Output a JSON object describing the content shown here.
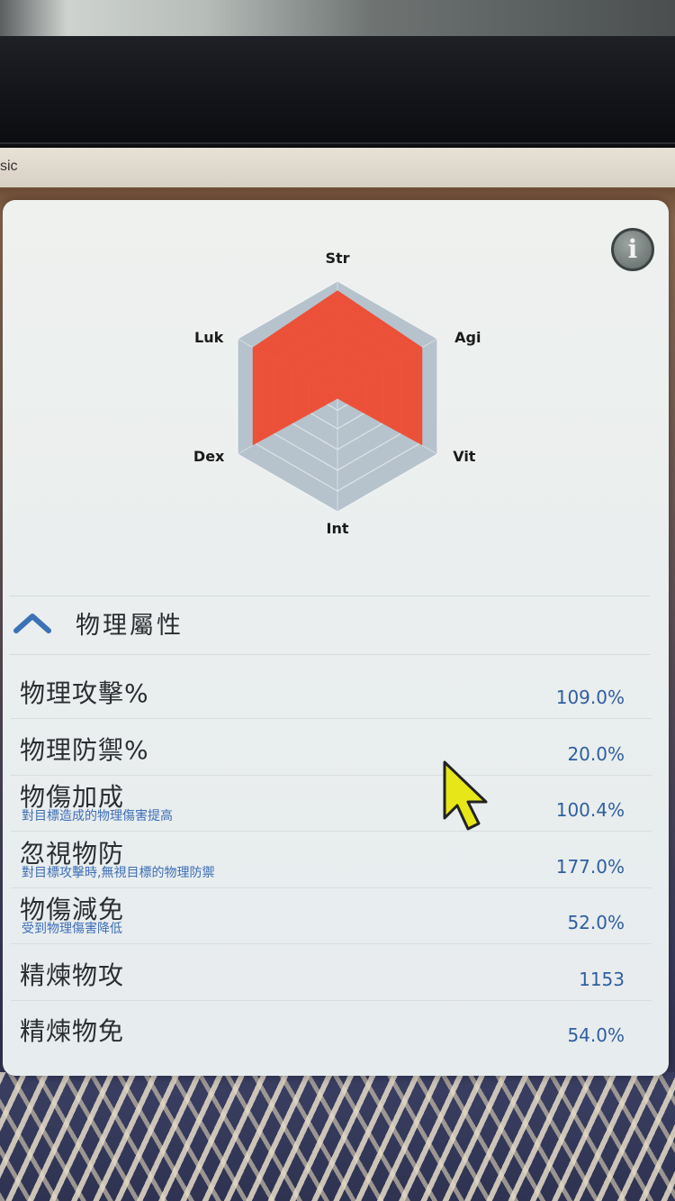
{
  "window": {
    "title_fragment": "sic"
  },
  "info_button": {
    "icon": "info-icon",
    "glyph": "i"
  },
  "chart_data": {
    "type": "radar",
    "axes": [
      "Str",
      "Agi",
      "Vit",
      "Int",
      "Dex",
      "Luk"
    ],
    "max": 1.0,
    "series": [
      {
        "values": [
          0.92,
          0.85,
          0.85,
          0.02,
          0.85,
          0.85
        ],
        "color": "#ee4a30"
      }
    ],
    "ring_color": "#b6c3cc"
  },
  "section": {
    "title": "物理屬性",
    "icon": "chevron-up-icon"
  },
  "stats": [
    {
      "label": "物理攻擊%",
      "sub": "",
      "value": "109.0%"
    },
    {
      "label": "物理防禦%",
      "sub": "",
      "value": "20.0%"
    },
    {
      "label": "物傷加成",
      "sub": "對目標造成的物理傷害提高",
      "value": "100.4%"
    },
    {
      "label": "忽視物防",
      "sub": "對目標攻擊時,無視目標的物理防禦",
      "value": "177.0%"
    },
    {
      "label": "物傷減免",
      "sub": "受到物理傷害降低",
      "value": "52.0%"
    },
    {
      "label": "精煉物攻",
      "sub": "",
      "value": "1153"
    },
    {
      "label": "精煉物免",
      "sub": "",
      "value": "54.0%"
    }
  ],
  "colors": {
    "accent_value": "#2f5f9e",
    "sub_text": "#3d6eb5",
    "radar_fill": "#ee4a30",
    "cursor": "#e6e619"
  }
}
